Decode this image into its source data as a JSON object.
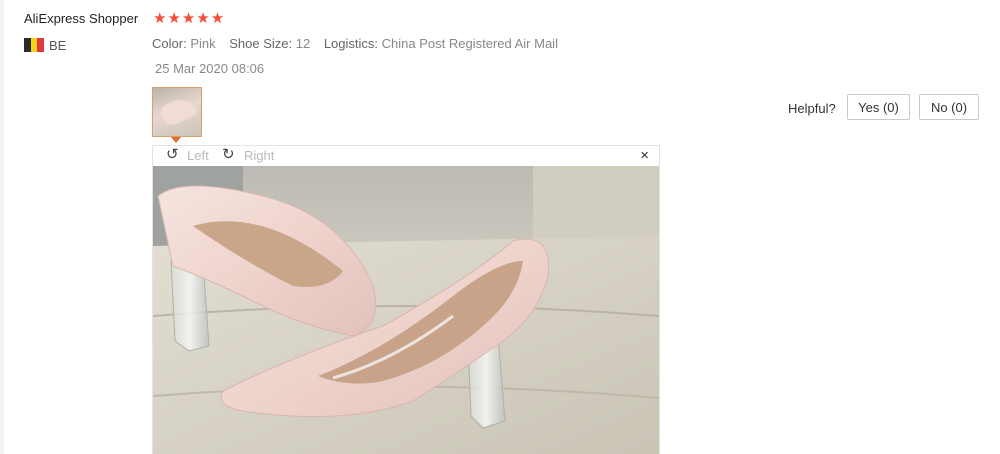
{
  "review": {
    "user_name": "AliExpress Shopper",
    "stars_text": "★★★★★",
    "rating": 5,
    "country_code": "BE",
    "flag_colors": [
      "#2b2b2b",
      "#f6d21b",
      "#e03a3e"
    ],
    "attributes": [
      {
        "label": "Color:",
        "value": "Pink"
      },
      {
        "label": "Shoe Size:",
        "value": "12"
      },
      {
        "label": "Logistics:",
        "value": "China Post Registered Air Mail"
      }
    ],
    "date": "25 Mar 2020 08:06"
  },
  "helpful": {
    "label": "Helpful?",
    "yes_label": "Yes (0)",
    "no_label": "No (0)"
  },
  "viewer": {
    "rotate_left_label": "Left",
    "rotate_right_label": "Right",
    "rotate_left_icon": "↺",
    "rotate_right_icon": "↻",
    "close_icon": "×"
  },
  "colors": {
    "star": "#f44d3a",
    "thumb_border": "#e0a063",
    "caret": "#e06a2a"
  }
}
